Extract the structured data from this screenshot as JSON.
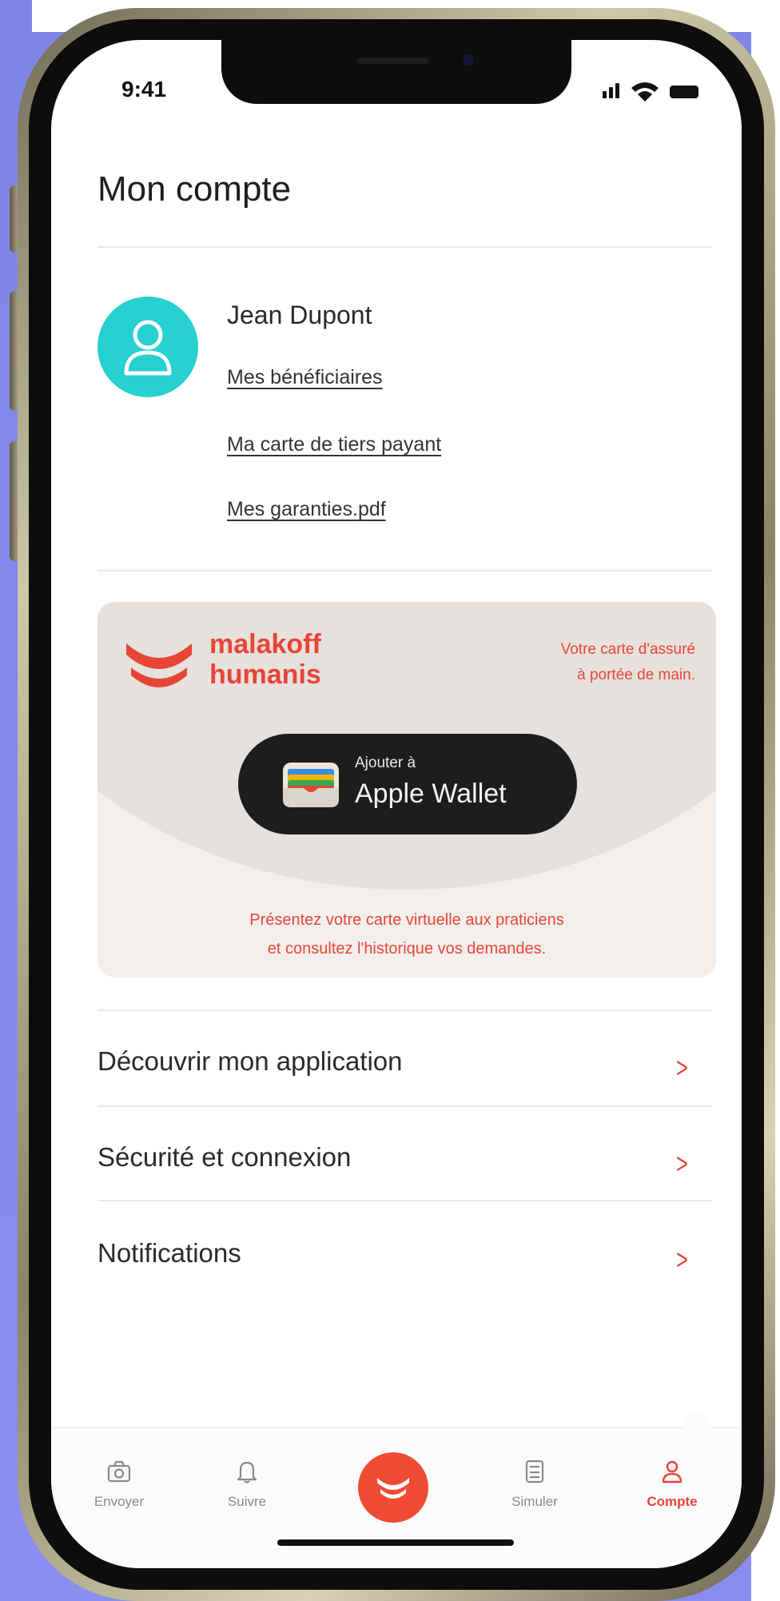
{
  "status_bar": {
    "time": "9:41"
  },
  "page": {
    "title": "Mon compte"
  },
  "profile": {
    "name": "Jean Dupont",
    "links": [
      "Mes bénéficiaires",
      "Ma carte de tiers payant",
      "Mes garanties.pdf"
    ]
  },
  "card": {
    "brand_line1": "malakoff",
    "brand_line2": "humanis",
    "tagline_line1": "Votre carte d'assuré",
    "tagline_line2": "à portée de main.",
    "wallet_small": "Ajouter à",
    "wallet_big": "Apple Wallet",
    "footer_line1": "Présentez votre carte virtuelle aux praticiens",
    "footer_line2": "et consultez l'historique vos demandes."
  },
  "menu": [
    {
      "label": "Découvrir mon application"
    },
    {
      "label": "Sécurité et connexion"
    },
    {
      "label": "Notifications"
    }
  ],
  "bottom_nav": [
    {
      "label": "Envoyer",
      "icon": "camera-icon",
      "active": false
    },
    {
      "label": "Suivre",
      "icon": "bell-icon",
      "active": false
    },
    {
      "label": "Simuler",
      "icon": "calculator-icon",
      "active": false
    },
    {
      "label": "Compte",
      "icon": "user-icon",
      "active": true
    }
  ],
  "colors": {
    "accent": "#e84537",
    "avatar": "#26cfd0",
    "background_side": "#8a8df0"
  }
}
